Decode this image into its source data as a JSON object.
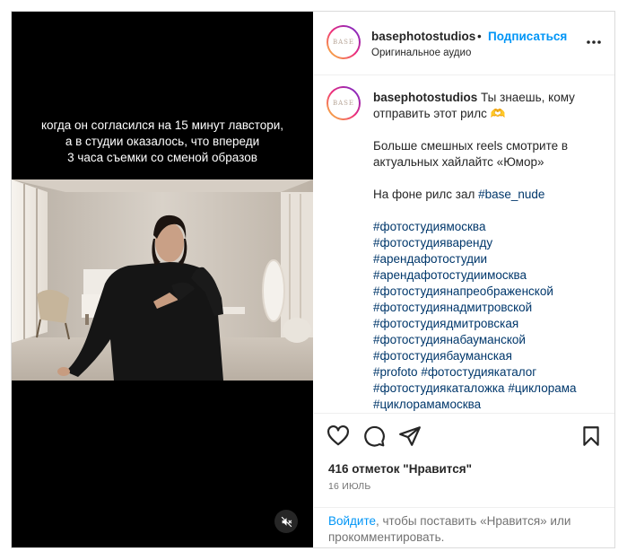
{
  "media": {
    "overlay_lines": [
      "когда он согласился на 15 минут лавстори,",
      "а в студии оказалось, что впереди",
      "3 часа съемки со сменой образов"
    ],
    "mute_icon": "speaker-muted-icon"
  },
  "header": {
    "avatar_text": "BASE",
    "username": "basephotostudios",
    "dot": "•",
    "follow_label": "Подписаться",
    "audio_label": "Оригинальное аудио",
    "more_icon": "more-options-icon"
  },
  "post": {
    "username": "basephotostudios",
    "text_first": "Ты знаешь, кому",
    "text_second": "отправить этот рилс 🫶",
    "promo_1": "Больше смешных reels смотрите в",
    "promo_2": "актуальных хайлайтс «Юмор»",
    "bg_text": "На фоне рилс зал",
    "bg_tag": "#base_nude",
    "hashtags": [
      "#фотостудиямосква",
      "#фотостудияваренду",
      "#арендафотостудии",
      "#арендафотостудиимосква",
      "#фотостудиянапреображенской",
      "#фотостудиянадмитровской",
      "#фотостудиядмитровская",
      "#фотостудиянабауманской",
      "#фотостудиябауманская"
    ],
    "tag_pair_1": [
      "#profoto",
      "#фотостудиякаталог"
    ],
    "tag_pair_2": [
      "#фотостудиякаталожка",
      "#циклорама"
    ],
    "tag_last": "#циклорамамосква"
  },
  "actions": {
    "like_icon": "heart-icon",
    "comment_icon": "comment-icon",
    "share_icon": "share-icon",
    "save_icon": "bookmark-icon"
  },
  "likes_text": "416 отметок \"Нравится\"",
  "date_text": "16 ИЮЛЬ",
  "login": {
    "link": "Войдите",
    "rest": ", чтобы поставить «Нравится» или прокомментировать."
  }
}
